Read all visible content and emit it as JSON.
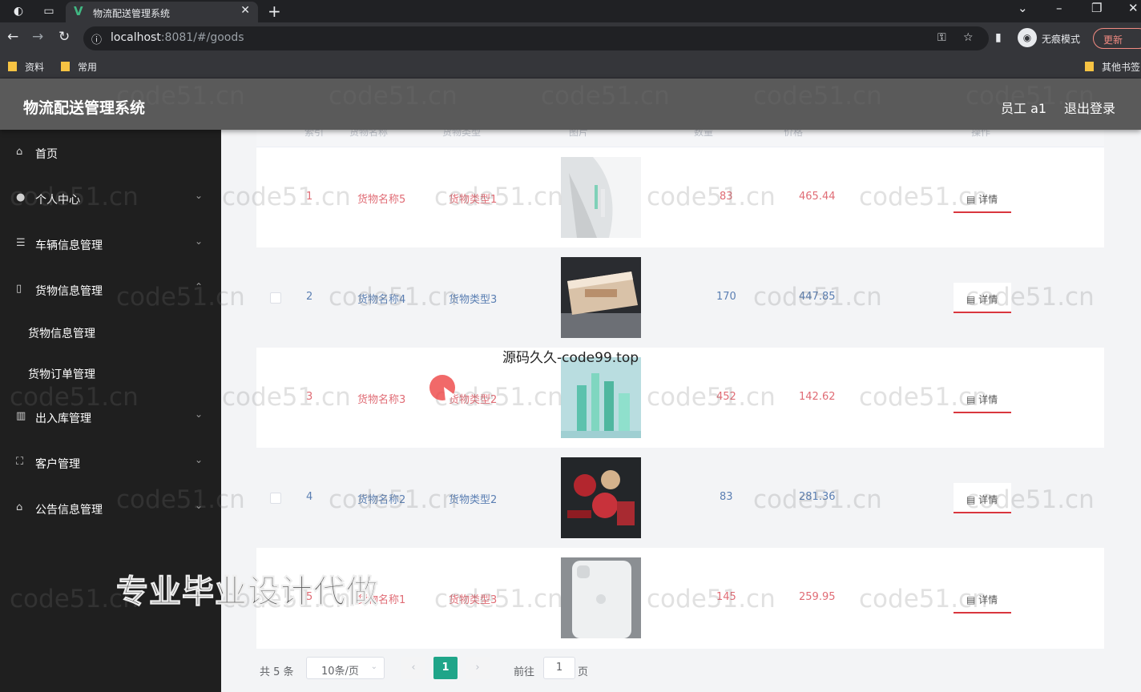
{
  "browser": {
    "tab_title": "物流配送管理系统",
    "url_host": "localhost",
    "url_path": ":8081/#/goods",
    "profile_label": "无痕模式",
    "update_label": "更新",
    "bookmarks": [
      "资料",
      "常用"
    ],
    "other_bookmarks": "其他书签"
  },
  "header": {
    "title": "物流配送管理系统",
    "user": "员工 a1",
    "logout": "退出登录"
  },
  "sidebar": {
    "items": [
      {
        "label": "首页",
        "icon": "home-icon"
      },
      {
        "label": "个人中心",
        "icon": "user-icon"
      },
      {
        "label": "车辆信息管理",
        "icon": "sliders-icon"
      },
      {
        "label": "货物信息管理",
        "icon": "phone-icon"
      },
      {
        "label": "货物信息管理",
        "icon": ""
      },
      {
        "label": "货物订单管理",
        "icon": ""
      },
      {
        "label": "出入库管理",
        "icon": "books-icon"
      },
      {
        "label": "客户管理",
        "icon": "frame-icon"
      },
      {
        "label": "公告信息管理",
        "icon": "bank-icon"
      }
    ]
  },
  "table": {
    "columns": [
      "索引",
      "货物名称",
      "货物类型",
      "图片",
      "数量",
      "价格",
      "操作"
    ],
    "rows": [
      {
        "index": "1",
        "name": "货物名称5",
        "type": "货物类型1",
        "qty": "83",
        "price": "465.44",
        "action": "详情"
      },
      {
        "index": "2",
        "name": "货物名称4",
        "type": "货物类型3",
        "qty": "170",
        "price": "447.85",
        "action": "详情"
      },
      {
        "index": "3",
        "name": "货物名称3",
        "type": "货物类型2",
        "qty": "452",
        "price": "142.62",
        "action": "详情"
      },
      {
        "index": "4",
        "name": "货物名称2",
        "type": "货物类型2",
        "qty": "83",
        "price": "281.36",
        "action": "详情"
      },
      {
        "index": "5",
        "name": "货物名称1",
        "type": "货物类型3",
        "qty": "145",
        "price": "259.95",
        "action": "详情"
      }
    ]
  },
  "pagination": {
    "total": "共 5 条",
    "page_size": "10条/页",
    "current": "1",
    "goto_label": "前往",
    "goto_value": "1",
    "page_unit": "页"
  },
  "watermarks": {
    "site": "code51.cn",
    "center": "源码久久-code99.top",
    "banner": "专业毕业设计代做"
  },
  "colors": {
    "accent": "#1fa589",
    "header_bg": "#5a5a5a",
    "sidebar_bg": "#1f1f1f",
    "highlight_red": "#e06c75",
    "blue_text": "#5b7fb3"
  }
}
